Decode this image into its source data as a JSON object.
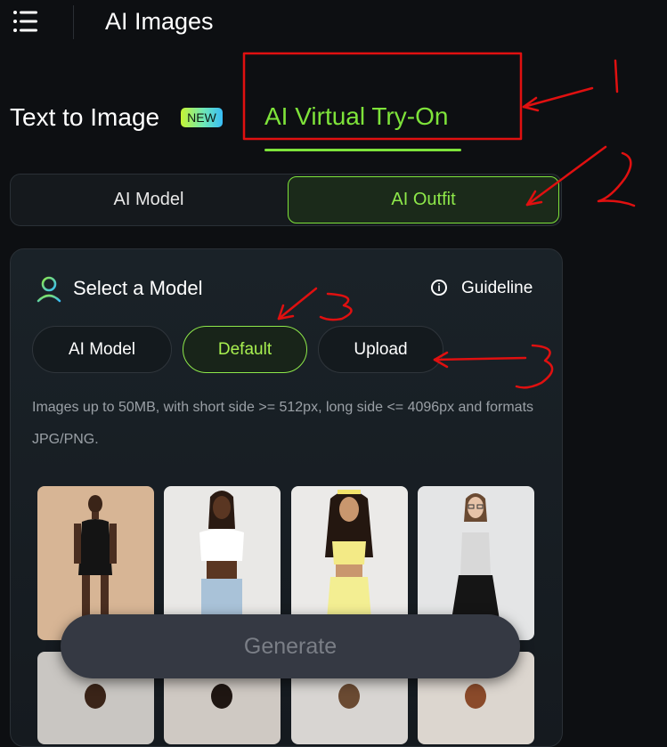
{
  "header": {
    "title": "AI Images",
    "menu_icon": "hamburger-menu-icon"
  },
  "mode_tabs": [
    {
      "label": "Text to Image",
      "badge": "NEW",
      "active": false
    },
    {
      "label": "AI Virtual Try-On",
      "active": true
    }
  ],
  "segmented": [
    {
      "label": "AI Model",
      "active": false
    },
    {
      "label": "AI Outfit",
      "active": true
    }
  ],
  "panel": {
    "title": "Select a Model",
    "title_icon": "person-icon",
    "guideline_label": "Guideline",
    "guideline_icon": "info-icon",
    "source_options": [
      {
        "label": "AI Model",
        "active": false
      },
      {
        "label": "Default",
        "active": true
      },
      {
        "label": "Upload",
        "active": false
      }
    ],
    "info_text": "Images up to 50MB, with short side >= 512px, long side <= 4096px and formats JPG/PNG."
  },
  "generate_label": "Generate",
  "annotations": [
    "1",
    "2",
    "3",
    "3"
  ],
  "colors": {
    "accent": "#7ee33a",
    "annotation": "#e01010",
    "background": "#0d0f12"
  }
}
